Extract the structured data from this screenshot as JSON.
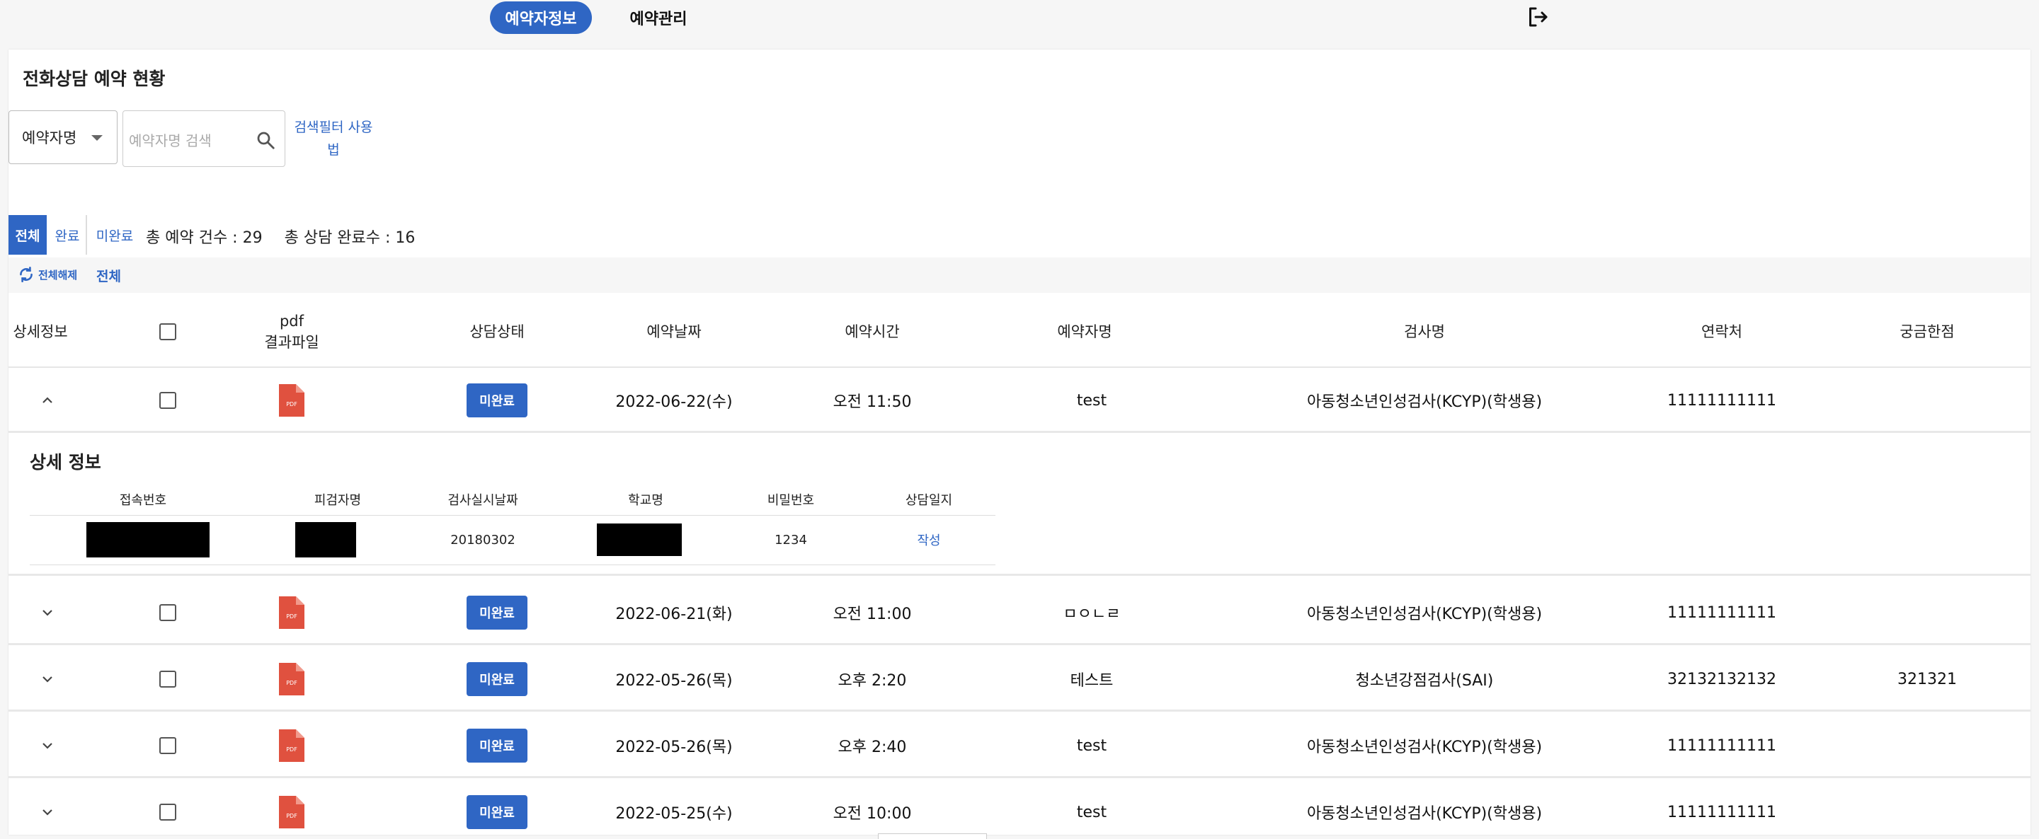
{
  "nav": {
    "tab_reservation_info": "예약자정보",
    "tab_reservation_manage": "예약관리"
  },
  "page": {
    "title": "전화상담 예약 현황"
  },
  "search": {
    "select_value": "예약자명",
    "placeholder": "예약자명 검색",
    "filter_help": "검색필터 사용법"
  },
  "filter_tabs": [
    "전체",
    "완료",
    "미완료"
  ],
  "stats": {
    "total_reservations": "총 예약 건수 : 29",
    "total_completed": "총 상담 완료수 : 16"
  },
  "toolbar": {
    "reset_label": "전체해제",
    "all_label": "전체"
  },
  "table": {
    "headers": [
      "상세정보",
      "",
      "pdf\n결과파일",
      "상담상태",
      "예약날짜",
      "예약시간",
      "예약자명",
      "검사명",
      "연락처",
      "궁금한점"
    ],
    "rows": [
      {
        "expanded": true,
        "status": "미완료",
        "date": "2022-06-22(수)",
        "time": "오전 11:50",
        "name": "test",
        "test": "아동청소년인성검사(KCYP)(학생용)",
        "phone": "11111111111",
        "question": ""
      },
      {
        "expanded": false,
        "status": "미완료",
        "date": "2022-06-21(화)",
        "time": "오전 11:00",
        "name": "ㅁㅇㄴㄹ",
        "test": "아동청소년인성검사(KCYP)(학생용)",
        "phone": "11111111111",
        "question": ""
      },
      {
        "expanded": false,
        "status": "미완료",
        "date": "2022-05-26(목)",
        "time": "오후 2:20",
        "name": "테스트",
        "test": "청소년강점검사(SAI)",
        "phone": "32132132132",
        "question": "321321"
      },
      {
        "expanded": false,
        "status": "미완료",
        "date": "2022-05-26(목)",
        "time": "오후 2:40",
        "name": "test",
        "test": "아동청소년인성검사(KCYP)(학생용)",
        "phone": "11111111111",
        "question": ""
      },
      {
        "expanded": false,
        "status": "미완료",
        "date": "2022-05-25(수)",
        "time": "오전 10:00",
        "name": "test",
        "test": "아동청소년인성검사(KCYP)(학생용)",
        "phone": "11111111111",
        "question": ""
      }
    ]
  },
  "detail": {
    "title": "상세 정보",
    "headers": [
      "접속번호",
      "피검자명",
      "검사실시날짜",
      "학교명",
      "비밀번호",
      "상담일지"
    ],
    "values": {
      "test_date": "20180302",
      "password": "1234",
      "log_link": "작성"
    }
  },
  "colors": {
    "accent": "#2f66c4",
    "pdf_red": "#e0513f"
  },
  "icons": {
    "logout": "logout-icon",
    "search": "search-icon",
    "pdf": "pdf-file-icon",
    "reset": "refresh-icon"
  }
}
